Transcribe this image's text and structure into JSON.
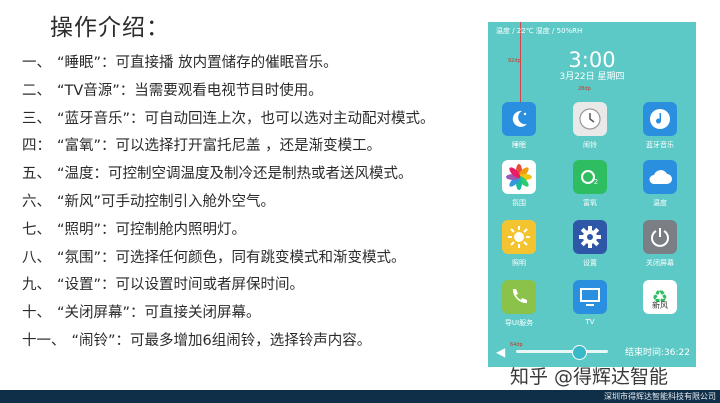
{
  "title": "操作介绍：",
  "items": [
    {
      "num": "一、",
      "text": "“睡眠”：可直接播 放内置储存的催眠音乐。"
    },
    {
      "num": "二、",
      "text": "“TV音源”：当需要观看电视节目时使用。"
    },
    {
      "num": "三、",
      "text": "“蓝牙音乐”：可自动回连上次，也可以选对主动配对模式。"
    },
    {
      "num": "四：",
      "text": "“富氧”：可以选择打开富托尼盖 ，还是渐变模工。"
    },
    {
      "num": "五、",
      "text": "“温度：可控制空调温度及制冷还是制热或者送风模式。"
    },
    {
      "num": "六、",
      "text": "“新风”可手动控制引入舱外空气。"
    },
    {
      "num": "七、",
      "text": "“照明”：可控制舱内照明灯。"
    },
    {
      "num": "八、",
      "text": "“氛围”：可选择任何颜色，同有跳变模式和渐变模式。"
    },
    {
      "num": "九、",
      "text": "“设置”：可以设置时间或者屏保时间。"
    },
    {
      "num": "十、",
      "text": "“关闭屏幕”：可直接关闭屏幕。"
    },
    {
      "num": "十一、",
      "text": "“闹铃”：可最多增加6组闹铃，选择铃声内容。"
    }
  ],
  "phone": {
    "status": "温度 / 22℃  湿度 / 50%RH",
    "time": "3:00",
    "date": "3月22日  星期四",
    "tick_a": "92dp",
    "tick_b": "28dp",
    "tick_c": "64dp",
    "apps": [
      {
        "label": "睡眠",
        "icon": "moon-icon",
        "bg": "#2b8fe0"
      },
      {
        "label": "闹铃",
        "icon": "clock-icon",
        "bg": "#e9e9e9"
      },
      {
        "label": "蓝牙音乐",
        "icon": "music-note-icon",
        "bg": "#2b8fe0"
      },
      {
        "label": "氛围",
        "icon": "flower-icon",
        "bg": "#ffffff"
      },
      {
        "label": "富氧",
        "icon": "oxygen-icon",
        "bg": "#2ebd61"
      },
      {
        "label": "温度",
        "icon": "cloud-icon",
        "bg": "#2b8fe0"
      },
      {
        "label": "照明",
        "icon": "sun-icon",
        "bg": "#f4c430"
      },
      {
        "label": "设置",
        "icon": "gear-icon",
        "bg": "#2f57a8"
      },
      {
        "label": "关闭屏幕",
        "icon": "power-icon",
        "bg": "#7a7f85"
      },
      {
        "label": "导UI服务",
        "icon": "phone-icon",
        "bg": "#8bc34a"
      },
      {
        "label": "TV",
        "icon": "tv-icon",
        "bg": "#2b8fe0"
      },
      {
        "label": "新风",
        "icon": "recycle-icon",
        "bg": "#ffffff"
      }
    ],
    "end_time": "结束时间:36:22",
    "volume_level": 0.68
  },
  "watermark": "知乎 @得辉达智能",
  "company": "深圳市得辉达智能科技有限公司"
}
